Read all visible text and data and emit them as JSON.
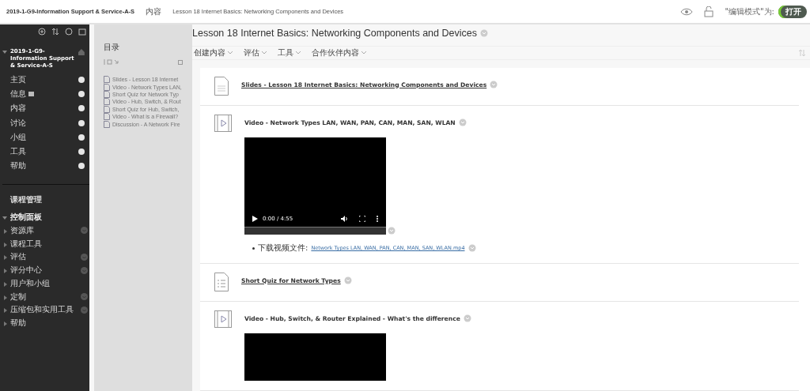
{
  "breadcrumbs": [
    {
      "label": "2019-1-G9-Information Support & Service-A-S",
      "kind": "course"
    },
    {
      "label": "内容",
      "kind": "section"
    },
    {
      "label": "Lesson 18 Internet Basics: Networking Components and Devices",
      "kind": "page"
    }
  ],
  "edit_mode": {
    "label": "\"编辑模式\"为:",
    "toggle": "打开",
    "on": true
  },
  "sidebar": {
    "course_title": "2019-1-G9-Information Support & Service-A-S",
    "menu": [
      {
        "label": "主页",
        "badge": false
      },
      {
        "label": "信息",
        "badge": true
      },
      {
        "label": "内容",
        "badge": false
      },
      {
        "label": "讨论",
        "badge": false
      },
      {
        "label": "小组",
        "badge": false
      },
      {
        "label": "工具",
        "badge": false
      },
      {
        "label": "帮助",
        "badge": false
      }
    ],
    "management_title": "课程管理",
    "control_panel": {
      "label": "控制面板",
      "expanded": true,
      "children": [
        {
          "label": "资源库",
          "menu": true
        },
        {
          "label": "课程工具",
          "menu": false
        },
        {
          "label": "评估",
          "menu": true
        },
        {
          "label": "评分中心",
          "menu": true
        },
        {
          "label": "用户和小组",
          "menu": false
        },
        {
          "label": "定制",
          "menu": true
        },
        {
          "label": "压缩包和实用工具",
          "menu": true
        },
        {
          "label": "帮助",
          "menu": false
        }
      ]
    }
  },
  "toc": {
    "title": "目录",
    "items": [
      "Slides - Lesson 18 Internet",
      "Video - Network Types LAN,",
      "Short Quiz for Network Typ",
      "Video - Hub, Switch, & Rout",
      "Short Quiz for Hub, Switch,",
      "Video - What is a Firewall?",
      "Discussion - A Network Fire"
    ]
  },
  "page_title": "Lesson 18 Internet Basics: Networking Components and Devices",
  "toolbar": [
    "创建内容",
    "评估",
    "工具",
    "合作伙伴内容"
  ],
  "content": [
    {
      "kind": "document",
      "title": "Slides - Lesson 18 Internet Basics: Networking Components and Devices",
      "link": true
    },
    {
      "kind": "video",
      "title": "Video - Network Types LAN, WAN, PAN, CAN, MAN, SAN, WLAN",
      "link": false,
      "player": {
        "time": "0:00 / 4:55",
        "full": true
      },
      "download_label": "下载视频文件:",
      "download_link": "Network Types LAN, WAN, PAN, CAN, MAN, SAN, WLAN.mp4"
    },
    {
      "kind": "quiz",
      "title": "Short Quiz for Network Types",
      "link": true
    },
    {
      "kind": "video",
      "title": "Video - Hub, Switch, & Router Explained - What's the difference",
      "link": false,
      "player": {
        "full": false
      }
    }
  ]
}
